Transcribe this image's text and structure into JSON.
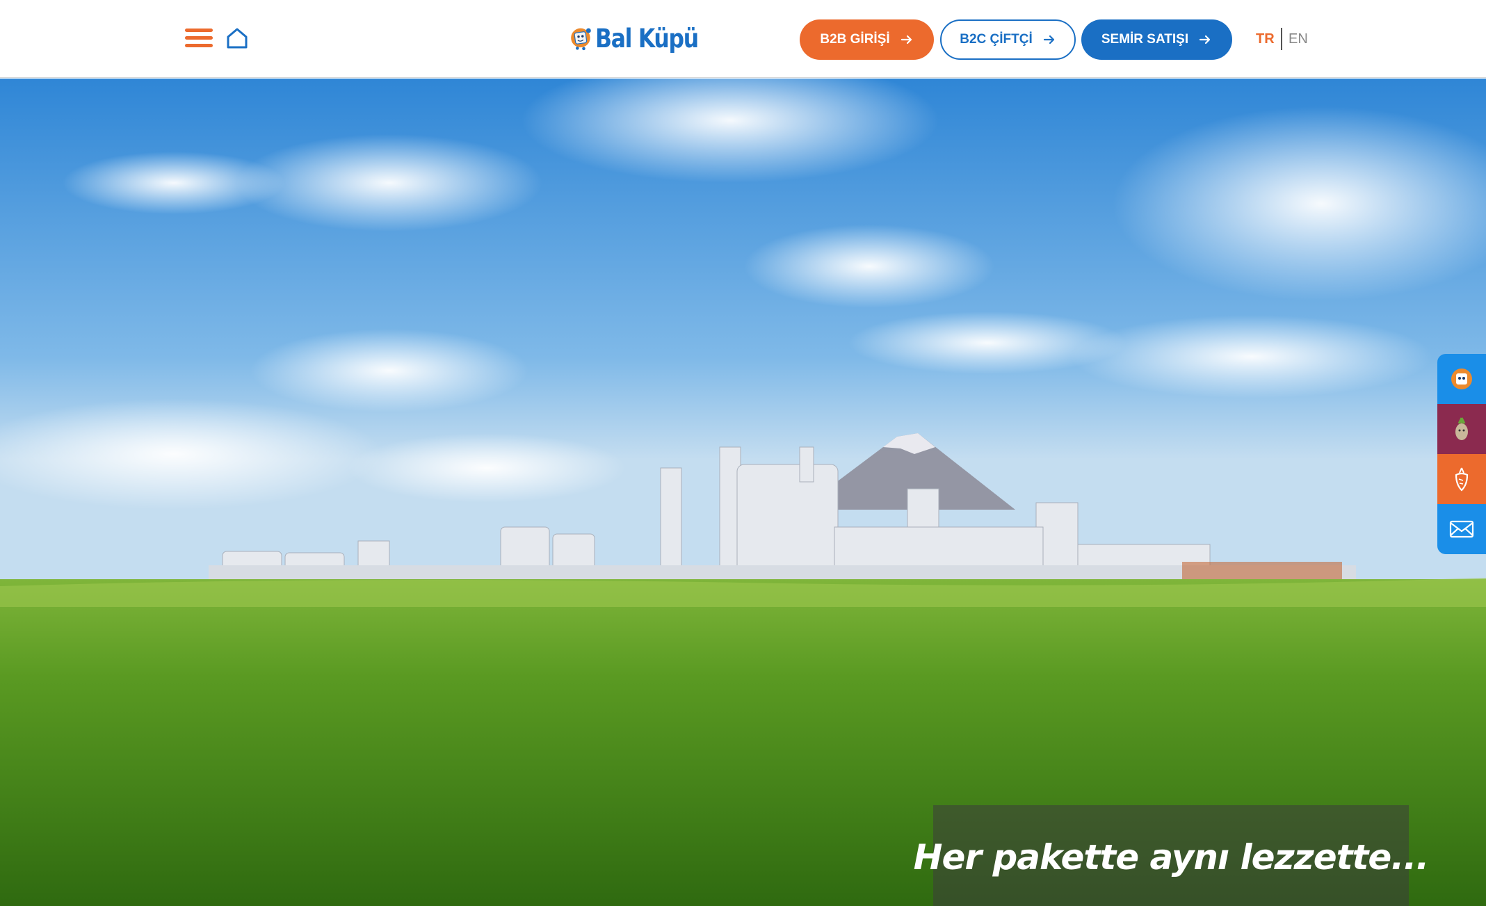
{
  "header": {
    "menu_icon": "hamburger-icon",
    "home_icon": "home-icon",
    "logo_text": "Bal Küpü",
    "buttons": [
      {
        "label": "B2B GİRİŞİ",
        "icon": "arrow-right-icon",
        "color": "#ec6a2d"
      },
      {
        "label": "B2C ÇİFTÇİ",
        "icon": "arrow-right-icon",
        "color": "#1a6fc4"
      },
      {
        "label": "SEMİR SATIŞI",
        "icon": "arrow-right-icon",
        "color": "#1a6fc4"
      }
    ],
    "languages": [
      {
        "label": "TR",
        "active": true
      },
      {
        "label": "EN",
        "active": false
      }
    ]
  },
  "hero": {
    "caption": "Her pakette aynı lezzette..."
  },
  "side_menu": [
    {
      "icon": "mascot-icon",
      "color": "#1a8ee8"
    },
    {
      "icon": "beet-character-icon",
      "color": "#8b2a4f"
    },
    {
      "icon": "sugar-beet-icon",
      "color": "#ec6a2d"
    },
    {
      "icon": "mail-icon",
      "color": "#1a8ee8"
    }
  ],
  "colors": {
    "brand_orange": "#ec6a2d",
    "brand_blue": "#1a6fc4"
  }
}
